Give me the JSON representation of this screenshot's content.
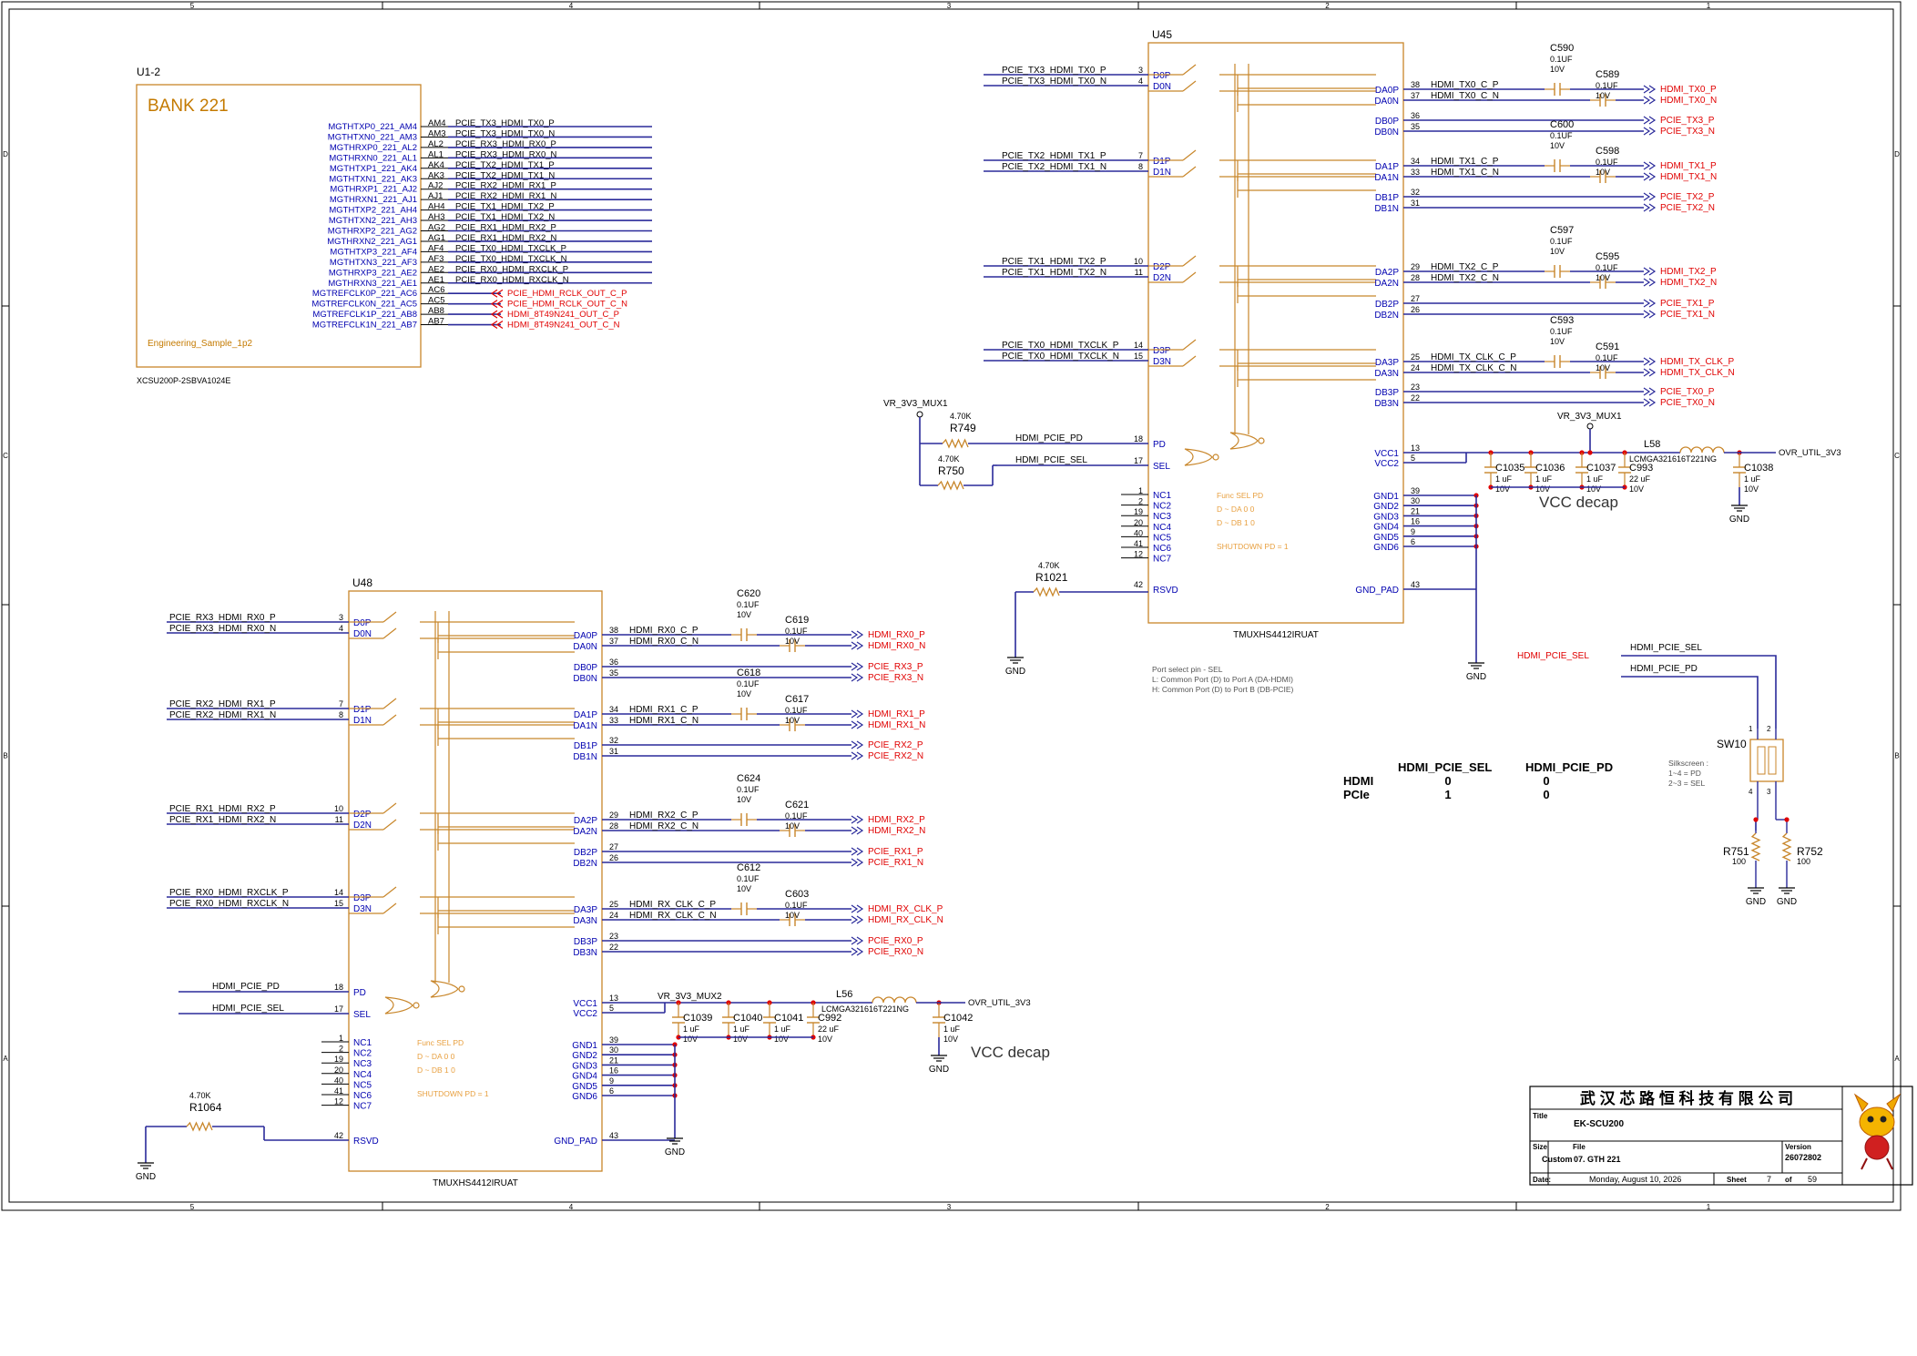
{
  "frame": {
    "col_numbers": [
      "5",
      "4",
      "3",
      "2",
      "1"
    ],
    "row_letters": [
      "D",
      "C",
      "B",
      "A"
    ]
  },
  "u1": {
    "ref": "U1-2",
    "bank": "BANK 221",
    "sample": "Engineering_Sample_1p2",
    "part": "XCSU200P-2SBVA1024E",
    "pins": [
      {
        "name": "MGTHTXP0_221_AM4",
        "ball": "AM4",
        "net": "PCIE_TX3_HDMI_TX0_P",
        "red": false
      },
      {
        "name": "MGTHTXN0_221_AM3",
        "ball": "AM3",
        "net": "PCIE_TX3_HDMI_TX0_N",
        "red": false
      },
      {
        "name": "MGTHRXP0_221_AL2",
        "ball": "AL2",
        "net": "PCIE_RX3_HDMI_RX0_P",
        "red": false
      },
      {
        "name": "MGTHRXN0_221_AL1",
        "ball": "AL1",
        "net": "PCIE_RX3_HDMI_RX0_N",
        "red": false
      },
      {
        "name": "MGTHTXP1_221_AK4",
        "ball": "AK4",
        "net": "PCIE_TX2_HDMI_TX1_P",
        "red": false
      },
      {
        "name": "MGTHTXN1_221_AK3",
        "ball": "AK3",
        "net": "PCIE_TX2_HDMI_TX1_N",
        "red": false
      },
      {
        "name": "MGTHRXP1_221_AJ2",
        "ball": "AJ2",
        "net": "PCIE_RX2_HDMI_RX1_P",
        "red": false
      },
      {
        "name": "MGTHRXN1_221_AJ1",
        "ball": "AJ1",
        "net": "PCIE_RX2_HDMI_RX1_N",
        "red": false
      },
      {
        "name": "MGTHTXP2_221_AH4",
        "ball": "AH4",
        "net": "PCIE_TX1_HDMI_TX2_P",
        "red": false
      },
      {
        "name": "MGTHTXN2_221_AH3",
        "ball": "AH3",
        "net": "PCIE_TX1_HDMI_TX2_N",
        "red": false
      },
      {
        "name": "MGTHRXP2_221_AG2",
        "ball": "AG2",
        "net": "PCIE_RX1_HDMI_RX2_P",
        "red": false
      },
      {
        "name": "MGTHRXN2_221_AG1",
        "ball": "AG1",
        "net": "PCIE_RX1_HDMI_RX2_N",
        "red": false
      },
      {
        "name": "MGTHTXP3_221_AF4",
        "ball": "AF4",
        "net": "PCIE_TX0_HDMI_TXCLK_P",
        "red": false
      },
      {
        "name": "MGTHTXN3_221_AF3",
        "ball": "AF3",
        "net": "PCIE_TX0_HDMI_TXCLK_N",
        "red": false
      },
      {
        "name": "MGTHRXP3_221_AE2",
        "ball": "AE2",
        "net": "PCIE_RX0_HDMI_RXCLK_P",
        "red": false
      },
      {
        "name": "MGTHRXN3_221_AE1",
        "ball": "AE1",
        "net": "PCIE_RX0_HDMI_RXCLK_N",
        "red": false
      },
      {
        "name": "MGTREFCLK0P_221_AC6",
        "ball": "AC6",
        "net": "PCIE_HDMI_RCLK_OUT_C_P",
        "red": true
      },
      {
        "name": "MGTREFCLK0N_221_AC5",
        "ball": "AC5",
        "net": "PCIE_HDMI_RCLK_OUT_C_N",
        "red": true
      },
      {
        "name": "MGTREFCLK1P_221_AB8",
        "ball": "AB8",
        "net": "HDMI_8T49N241_OUT_C_P",
        "red": true
      },
      {
        "name": "MGTREFCLK1N_221_AB7",
        "ball": "AB7",
        "net": "HDMI_8T49N241_OUT_C_N",
        "red": true
      }
    ]
  },
  "u45": {
    "ref": "U45",
    "part": "TMUXHS4412IRUAT",
    "left_pins": [
      {
        "net": "PCIE_TX3_HDMI_TX0_P",
        "num": "3",
        "pin": "D0P"
      },
      {
        "net": "PCIE_TX3_HDMI_TX0_N",
        "num": "4",
        "pin": "D0N"
      },
      {
        "net": "PCIE_TX2_HDMI_TX1_P",
        "num": "7",
        "pin": "D1P"
      },
      {
        "net": "PCIE_TX2_HDMI_TX1_N",
        "num": "8",
        "pin": "D1N"
      },
      {
        "net": "PCIE_TX1_HDMI_TX2_P",
        "num": "10",
        "pin": "D2P"
      },
      {
        "net": "PCIE_TX1_HDMI_TX2_N",
        "num": "11",
        "pin": "D2N"
      },
      {
        "net": "PCIE_TX0_HDMI_TXCLK_P",
        "num": "14",
        "pin": "D3P"
      },
      {
        "net": "PCIE_TX0_HDMI_TXCLK_N",
        "num": "15",
        "pin": "D3N"
      }
    ],
    "right_pins": [
      {
        "pin": "DA0P",
        "num": "38",
        "net": "HDMI_TX0_C_P",
        "out": "HDMI_TX0_P"
      },
      {
        "pin": "DA0N",
        "num": "37",
        "net": "HDMI_TX0_C_N",
        "out": "HDMI_TX0_N"
      },
      {
        "pin": "DB0P",
        "num": "36",
        "net": "",
        "out": "PCIE_TX3_P"
      },
      {
        "pin": "DB0N",
        "num": "35",
        "net": "",
        "out": "PCIE_TX3_N"
      },
      {
        "pin": "DA1P",
        "num": "34",
        "net": "HDMI_TX1_C_P",
        "out": "HDMI_TX1_P"
      },
      {
        "pin": "DA1N",
        "num": "33",
        "net": "HDMI_TX1_C_N",
        "out": "HDMI_TX1_N"
      },
      {
        "pin": "DB1P",
        "num": "32",
        "net": "",
        "out": "PCIE_TX2_P"
      },
      {
        "pin": "DB1N",
        "num": "31",
        "net": "",
        "out": "PCIE_TX2_N"
      },
      {
        "pin": "DA2P",
        "num": "29",
        "net": "HDMI_TX2_C_P",
        "out": "HDMI_TX2_P"
      },
      {
        "pin": "DA2N",
        "num": "28",
        "net": "HDMI_TX2_C_N",
        "out": "HDMI_TX2_N"
      },
      {
        "pin": "DB2P",
        "num": "27",
        "net": "",
        "out": "PCIE_TX1_P"
      },
      {
        "pin": "DB2N",
        "num": "26",
        "net": "",
        "out": "PCIE_TX1_N"
      },
      {
        "pin": "DA3P",
        "num": "25",
        "net": "HDMI_TX_CLK_C_P",
        "out": "HDMI_TX_CLK_P"
      },
      {
        "pin": "DA3N",
        "num": "24",
        "net": "HDMI_TX_CLK_C_N",
        "out": "HDMI_TX_CLK_N"
      },
      {
        "pin": "DB3P",
        "num": "23",
        "net": "",
        "out": "PCIE_TX0_P"
      },
      {
        "pin": "DB3N",
        "num": "22",
        "net": "",
        "out": "PCIE_TX0_N"
      }
    ],
    "caps": [
      {
        "ref": "C590",
        "val": "0.1UF",
        "volt": "10V"
      },
      {
        "ref": "C589",
        "val": "0.1UF",
        "volt": "10V"
      },
      {
        "ref": "C600",
        "val": "0.1UF",
        "volt": "10V"
      },
      {
        "ref": "C598",
        "val": "0.1UF",
        "volt": "10V"
      },
      {
        "ref": "C597",
        "val": "0.1UF",
        "volt": "10V"
      },
      {
        "ref": "C595",
        "val": "0.1UF",
        "volt": "10V"
      },
      {
        "ref": "C593",
        "val": "0.1UF",
        "volt": "10V"
      },
      {
        "ref": "C591",
        "val": "0.1UF",
        "volt": "10V"
      }
    ],
    "pd_pin": {
      "num": "18",
      "pin": "PD",
      "net": "HDMI_PCIE_PD"
    },
    "sel_pin": {
      "num": "17",
      "pin": "SEL",
      "net": "HDMI_PCIE_SEL"
    },
    "vcc_pins": [
      {
        "pin": "VCC1",
        "num": "13"
      },
      {
        "pin": "VCC2",
        "num": "5"
      }
    ],
    "gnd_pins": [
      {
        "pin": "GND1",
        "num": "39"
      },
      {
        "pin": "GND2",
        "num": "30"
      },
      {
        "pin": "GND3",
        "num": "21"
      },
      {
        "pin": "GND4",
        "num": "16"
      },
      {
        "pin": "GND5",
        "num": "9"
      },
      {
        "pin": "GND6",
        "num": "6"
      }
    ],
    "gnd_pad": {
      "pin": "GND_PAD",
      "num": "43"
    },
    "nc_pins": [
      {
        "pin": "NC1",
        "num": "1"
      },
      {
        "pin": "NC2",
        "num": "2"
      },
      {
        "pin": "NC3",
        "num": "19"
      },
      {
        "pin": "NC4",
        "num": "20"
      },
      {
        "pin": "NC5",
        "num": "40"
      },
      {
        "pin": "NC6",
        "num": "41"
      },
      {
        "pin": "NC7",
        "num": "12"
      }
    ],
    "rsvd": {
      "pin": "RSVD",
      "num": "42"
    },
    "func_table": [
      "Func    SEL  PD",
      "D ~ DA    0   0",
      "D ~ DB    1   0",
      "SHUTDOWN   PD = 1"
    ],
    "mux_net": "VR_3V3_MUX1",
    "r749": {
      "ref": "R749",
      "val": "4.70K"
    },
    "r750": {
      "ref": "R750",
      "val": "4.70K"
    },
    "r1021": {
      "ref": "R1021",
      "val": "4.70K"
    },
    "decaps": [
      {
        "ref": "C1035",
        "val": "1 uF",
        "volt": "10V"
      },
      {
        "ref": "C1036",
        "val": "1 uF",
        "volt": "10V"
      },
      {
        "ref": "C1037",
        "val": "1 uF",
        "volt": "10V"
      },
      {
        "ref": "C993",
        "val": "22 uF",
        "volt": "10V"
      },
      {
        "ref": "C1038",
        "val": "1 uF",
        "volt": "10V"
      }
    ],
    "inductor": {
      "ref": "L58",
      "part": "LCMGA321616T221NG"
    },
    "rail": "OVR_UTIL_3V3",
    "decap_label": "VCC decap",
    "port_note": [
      "Port select pin - SEL",
      "L: Common Port (D) to Port A (DA-HDMI)",
      "H: Common Port (D) to Port B (DB-PCIE)"
    ]
  },
  "u48": {
    "ref": "U48",
    "part": "TMUXHS4412IRUAT",
    "left_pins": [
      {
        "net": "PCIE_RX3_HDMI_RX0_P",
        "num": "3",
        "pin": "D0P"
      },
      {
        "net": "PCIE_RX3_HDMI_RX0_N",
        "num": "4",
        "pin": "D0N"
      },
      {
        "net": "PCIE_RX2_HDMI_RX1_P",
        "num": "7",
        "pin": "D1P"
      },
      {
        "net": "PCIE_RX2_HDMI_RX1_N",
        "num": "8",
        "pin": "D1N"
      },
      {
        "net": "PCIE_RX1_HDMI_RX2_P",
        "num": "10",
        "pin": "D2P"
      },
      {
        "net": "PCIE_RX1_HDMI_RX2_N",
        "num": "11",
        "pin": "D2N"
      },
      {
        "net": "PCIE_RX0_HDMI_RXCLK_P",
        "num": "14",
        "pin": "D3P"
      },
      {
        "net": "PCIE_RX0_HDMI_RXCLK_N",
        "num": "15",
        "pin": "D3N"
      }
    ],
    "right_pins": [
      {
        "pin": "DA0P",
        "num": "38",
        "net": "HDMI_RX0_C_P",
        "out": "HDMI_RX0_P"
      },
      {
        "pin": "DA0N",
        "num": "37",
        "net": "HDMI_RX0_C_N",
        "out": "HDMI_RX0_N"
      },
      {
        "pin": "DB0P",
        "num": "36",
        "net": "",
        "out": "PCIE_RX3_P"
      },
      {
        "pin": "DB0N",
        "num": "35",
        "net": "",
        "out": "PCIE_RX3_N"
      },
      {
        "pin": "DA1P",
        "num": "34",
        "net": "HDMI_RX1_C_P",
        "out": "HDMI_RX1_P"
      },
      {
        "pin": "DA1N",
        "num": "33",
        "net": "HDMI_RX1_C_N",
        "out": "HDMI_RX1_N"
      },
      {
        "pin": "DB1P",
        "num": "32",
        "net": "",
        "out": "PCIE_RX2_P"
      },
      {
        "pin": "DB1N",
        "num": "31",
        "net": "",
        "out": "PCIE_RX2_N"
      },
      {
        "pin": "DA2P",
        "num": "29",
        "net": "HDMI_RX2_C_P",
        "out": "HDMI_RX2_P"
      },
      {
        "pin": "DA2N",
        "num": "28",
        "net": "HDMI_RX2_C_N",
        "out": "HDMI_RX2_N"
      },
      {
        "pin": "DB2P",
        "num": "27",
        "net": "",
        "out": "PCIE_RX1_P"
      },
      {
        "pin": "DB2N",
        "num": "26",
        "net": "",
        "out": "PCIE_RX1_N"
      },
      {
        "pin": "DA3P",
        "num": "25",
        "net": "HDMI_RX_CLK_C_P",
        "out": "HDMI_RX_CLK_P"
      },
      {
        "pin": "DA3N",
        "num": "24",
        "net": "HDMI_RX_CLK_C_N",
        "out": "HDMI_RX_CLK_N"
      },
      {
        "pin": "DB3P",
        "num": "23",
        "net": "",
        "out": "PCIE_RX0_P"
      },
      {
        "pin": "DB3N",
        "num": "22",
        "net": "",
        "out": "PCIE_RX0_N"
      }
    ],
    "caps": [
      {
        "ref": "C620",
        "val": "0.1UF",
        "volt": "10V"
      },
      {
        "ref": "C619",
        "val": "0.1UF",
        "volt": "10V"
      },
      {
        "ref": "C618",
        "val": "0.1UF",
        "volt": "10V"
      },
      {
        "ref": "C617",
        "val": "0.1UF",
        "volt": "10V"
      },
      {
        "ref": "C624",
        "val": "0.1UF",
        "volt": "10V"
      },
      {
        "ref": "C621",
        "val": "0.1UF",
        "volt": "10V"
      },
      {
        "ref": "C612",
        "val": "0.1UF",
        "volt": "10V"
      },
      {
        "ref": "C603",
        "val": "0.1UF",
        "volt": "10V"
      }
    ],
    "pd_pin": {
      "num": "18",
      "pin": "PD",
      "net": "HDMI_PCIE_PD"
    },
    "sel_pin": {
      "num": "17",
      "pin": "SEL",
      "net": "HDMI_PCIE_SEL"
    },
    "vcc_pins": [
      {
        "pin": "VCC1",
        "num": "13"
      },
      {
        "pin": "VCC2",
        "num": "5"
      }
    ],
    "gnd_pins": [
      {
        "pin": "GND1",
        "num": "39"
      },
      {
        "pin": "GND2",
        "num": "30"
      },
      {
        "pin": "GND3",
        "num": "21"
      },
      {
        "pin": "GND4",
        "num": "16"
      },
      {
        "pin": "GND5",
        "num": "9"
      },
      {
        "pin": "GND6",
        "num": "6"
      }
    ],
    "gnd_pad": {
      "pin": "GND_PAD",
      "num": "43"
    },
    "nc_pins": [
      {
        "pin": "NC1",
        "num": "1"
      },
      {
        "pin": "NC2",
        "num": "2"
      },
      {
        "pin": "NC3",
        "num": "19"
      },
      {
        "pin": "NC4",
        "num": "20"
      },
      {
        "pin": "NC5",
        "num": "40"
      },
      {
        "pin": "NC6",
        "num": "41"
      },
      {
        "pin": "NC7",
        "num": "12"
      }
    ],
    "rsvd": {
      "pin": "RSVD",
      "num": "42"
    },
    "func_table": [
      "Func    SEL  PD",
      "D ~ DA    0   0",
      "D ~ DB    1   0",
      "SHUTDOWN   PD = 1"
    ],
    "mux_net": "VR_3V3_MUX2",
    "r1064": {
      "ref": "R1064",
      "val": "4.70K"
    },
    "decaps": [
      {
        "ref": "C1039",
        "val": "1 uF",
        "volt": "10V"
      },
      {
        "ref": "C1040",
        "val": "1 uF",
        "volt": "10V"
      },
      {
        "ref": "C1041",
        "val": "1 uF",
        "volt": "10V"
      },
      {
        "ref": "C992",
        "val": "22 uF",
        "volt": "10V"
      },
      {
        "ref": "C1042",
        "val": "1 uF",
        "volt": "10V"
      }
    ],
    "inductor": {
      "ref": "L56",
      "part": "LCMGA321616T221NG"
    },
    "rail": "OVR_UTIL_3V3",
    "decap_label": "VCC decap"
  },
  "sw10": {
    "ref": "SW10",
    "sel_net": "HDMI_PCIE_SEL",
    "pd_net": "HDMI_PCIE_PD",
    "silkscreen": [
      "Silkscreen :",
      "1~4 = PD",
      "2~3 = SEL"
    ],
    "pin_nums": [
      "1",
      "2",
      "4",
      "3"
    ],
    "r751": {
      "ref": "R751",
      "val": "100"
    },
    "r752": {
      "ref": "R752",
      "val": "100"
    }
  },
  "truth_table": {
    "headers": [
      "HDMI_PCIE_SEL",
      "HDMI_PCIE_PD"
    ],
    "rows": [
      {
        "name": "HDMI",
        "sel": "0",
        "pd": "0"
      },
      {
        "name": "PCIe",
        "sel": "1",
        "pd": "0"
      }
    ]
  },
  "gnd_label": "GND",
  "title_block": {
    "company": "武 汉 芯 路 恒 科 技 有 限 公 司",
    "title_label": "Title",
    "title": "EK-SCU200",
    "size_label": "Size",
    "size": "Custom",
    "file_label": "File",
    "file": "07. GTH 221",
    "version_label": "Version",
    "version": "26072802",
    "date_label": "Date:",
    "date": "Monday, August 10, 2026",
    "sheet_label": "Sheet",
    "sheet": "7",
    "of_label": "of",
    "total": "59"
  }
}
